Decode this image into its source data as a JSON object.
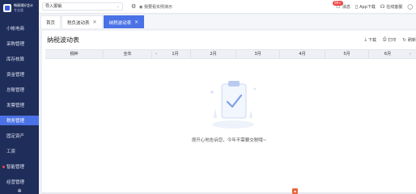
{
  "sidebar": {
    "logo_line1": "畅捷通好会计",
    "logo_line2": "专业版",
    "items": [
      {
        "label": "小帐电商"
      },
      {
        "label": "采购管理"
      },
      {
        "label": "库存核算"
      },
      {
        "label": "资金管理"
      },
      {
        "label": "总账管理"
      },
      {
        "label": "发票管理"
      },
      {
        "label": "税务管理"
      },
      {
        "label": "固定资产"
      },
      {
        "label": "工资"
      },
      {
        "label": "智能管理"
      },
      {
        "label": "经营管理"
      }
    ],
    "active_index": 6,
    "footer_icon": "settings-icon"
  },
  "topbar": {
    "company": "导入报销",
    "demo_link": "我要看实例演示",
    "messages_label": "消息",
    "messages_badge": "99+",
    "app_label": "App下载",
    "service_label": "在线客服",
    "user_icon": "user-icon"
  },
  "tabs": [
    {
      "label": "首页",
      "closable": false,
      "active": false
    },
    {
      "label": "税负波动表",
      "closable": true,
      "active": false
    },
    {
      "label": "纳税波动表",
      "closable": true,
      "active": true
    }
  ],
  "page": {
    "title": "纳税波动表",
    "actions": {
      "download": "下载",
      "print": "打印",
      "refresh": "刷新"
    },
    "columns": {
      "tax_type": "税种",
      "full_year": "全年",
      "months": [
        "1月",
        "2月",
        "3月",
        "4月",
        "5月",
        "6月"
      ]
    },
    "empty_message": "很开心地告诉您，今年不需要交税哦~"
  },
  "colors": {
    "sidebar_bg": "#1f2d5a",
    "accent": "#4a72e6",
    "badge": "#f04848"
  }
}
